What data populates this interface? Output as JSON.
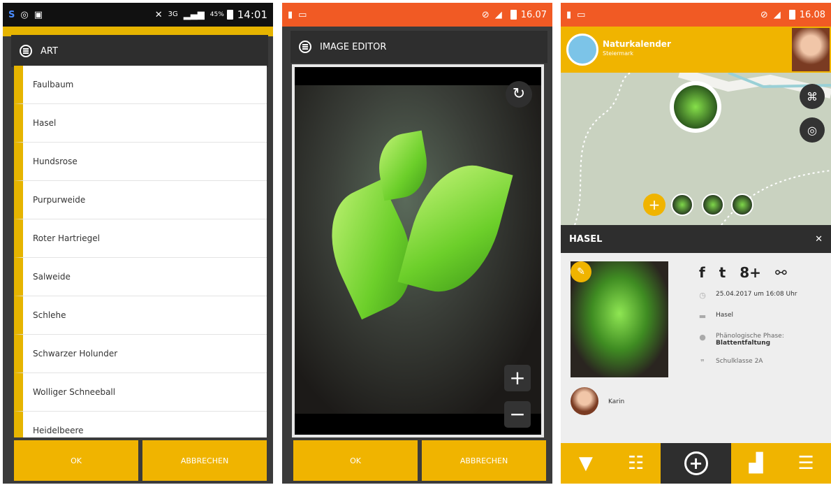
{
  "panel1": {
    "status": {
      "icons": [
        "skype-icon",
        "whatsapp-icon",
        "gallery-icon"
      ],
      "network": "3G",
      "battery": "45%",
      "time": "14:01"
    },
    "dialog_title": "ART",
    "items": [
      "Faulbaum",
      "Hasel",
      "Hundsrose",
      "Purpurweide",
      "Roter Hartriegel",
      "Salweide",
      "Schlehe",
      "Schwarzer Holunder",
      "Wolliger Schneeball",
      "Heidelbeere"
    ],
    "ok_label": "OK",
    "cancel_label": "ABBRECHEN"
  },
  "panel2": {
    "status": {
      "time": "16.07"
    },
    "dialog_title": "IMAGE EDITOR",
    "rotate_icon": "↻",
    "zoom_in": "+",
    "zoom_out": "−",
    "ok_label": "OK",
    "cancel_label": "ABBRECHEN"
  },
  "panel3": {
    "status": {
      "time": "16.08"
    },
    "app_title": "Naturkalender",
    "app_subtitle": "Steiermark",
    "detail_title": "HASEL",
    "close_icon": "✕",
    "social": {
      "facebook": "f",
      "twitter": "t",
      "google": "8+",
      "link": "⚯"
    },
    "date": "25.04.2017 um 16:08 Uhr",
    "species": "Hasel",
    "phase_label": "Phänologische Phase:",
    "phase_value": "Blattentfaltung",
    "class": "Schulklasse 2A",
    "author": "Karin"
  },
  "colors": {
    "accent": "#f0b400",
    "statusbar": "#f15a24",
    "dark": "#2e2e2e"
  }
}
